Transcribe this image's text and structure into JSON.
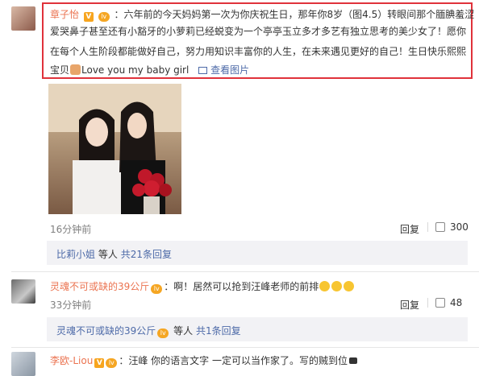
{
  "comment1": {
    "author": "章子怡",
    "v_badge": "V",
    "level_badge": "lv",
    "text_lines": [
      "：六年前的今天妈妈第一次为你庆祝生日，那年你8岁（图4.5）转眼间那个腼腆羞涩",
      "爱哭鼻子甚至还有小豁牙的小萝莉已经蜕变为一个亭亭玉立多才多艺有独立思考的美少女了！愿你",
      "在每个人生阶段都能做好自己，努力用知识丰富你的人生，在未来遇见更好的自己！生日快乐熙熙",
      "宝贝",
      "Love you my baby girl"
    ],
    "view_image": "查看图片",
    "time": "16分钟前",
    "reply_label": "回复",
    "like_count": "300",
    "replies_summary": {
      "user": "比莉小姐",
      "etc": "等人",
      "total": "共21条回复"
    }
  },
  "comment2": {
    "author": "灵魂不可或缺的39公斤",
    "text": "：啊！居然可以抢到汪峰老师的前排",
    "time": "33分钟前",
    "reply_label": "回复",
    "like_count": "48",
    "replies_summary": {
      "user": "灵魂不可或缺的39公斤",
      "etc": "等人",
      "total": "共1条回复"
    }
  },
  "comment3": {
    "author": "李欧-Liou",
    "v_badge": "V",
    "text": "：汪峰 你的语言文字 一定可以当作家了。写的贼到位"
  },
  "colors": {
    "name": "#eb7350",
    "link": "#4d6aa8",
    "highlight_border": "#e0323b",
    "reply_bg": "#f2f2f5"
  }
}
